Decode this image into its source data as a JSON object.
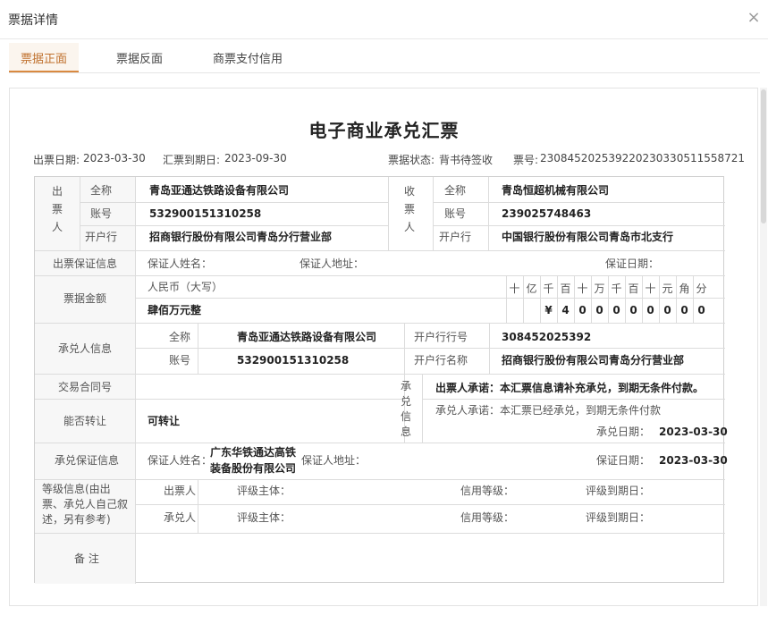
{
  "dialog": {
    "title": "票据详情",
    "close": "×"
  },
  "tabs": [
    {
      "label": "票据正面"
    },
    {
      "label": "票据反面"
    },
    {
      "label": "商票支付信用"
    }
  ],
  "bill": {
    "title": "电子商业承兑汇票",
    "issue_date_label": "出票日期:",
    "issue_date": "2023-03-30",
    "due_date_label": "汇票到期日:",
    "due_date": "2023-09-30",
    "status_label": "票据状态:",
    "status": "背书待签收",
    "number_label": "票号:",
    "number": "230845202539220230330511558721"
  },
  "drawer": {
    "side_label": "出票人",
    "name_label": "全称",
    "name": "青岛亚通达铁路设备有限公司",
    "account_label": "账号",
    "account": "532900151310258",
    "bank_label": "开户行",
    "bank": "招商银行股份有限公司青岛分行营业部"
  },
  "payee": {
    "side_label": "收票人",
    "name_label": "全称",
    "name": "青岛恒超机械有限公司",
    "account_label": "账号",
    "account": "239025748463",
    "bank_label": "开户行",
    "bank": "中国银行股份有限公司青岛市北支行"
  },
  "guarantee": {
    "label": "出票保证信息",
    "guarantor_name_label": "保证人姓名：",
    "guarantor_addr_label": "保证人地址：",
    "date_label": "保证日期："
  },
  "amount": {
    "label": "票据金额",
    "rmb_label": "人民币（大写）",
    "words": "肆佰万元整",
    "units": [
      "十",
      "亿",
      "千",
      "百",
      "十",
      "万",
      "千",
      "百",
      "十",
      "元",
      "角",
      "分"
    ],
    "digits": [
      "",
      "",
      "¥",
      "4",
      "0",
      "0",
      "0",
      "0",
      "0",
      "0",
      "0",
      "0"
    ]
  },
  "acceptor": {
    "label": "承兑人信息",
    "name_label": "全称",
    "name": "青岛亚通达铁路设备有限公司",
    "account_label": "账号",
    "account": "532900151310258",
    "bank_no_label": "开户行行号",
    "bank_no": "308452025392",
    "bank_name_label": "开户行名称",
    "bank_name": "招商银行股份有限公司青岛分行营业部"
  },
  "contract": {
    "label": "交易合同号"
  },
  "transferable": {
    "label": "能否转让",
    "value": "可转让"
  },
  "acceptance": {
    "side_label": "承兑信息",
    "drawer_promise": "出票人承诺：本汇票信息请补充承兑，到期无条件付款。",
    "acceptor_promise": "承兑人承诺：本汇票已经承兑，到期无条件付款",
    "date_label": "承兑日期：",
    "date": "2023-03-30"
  },
  "accept_guarantee": {
    "label": "承兑保证信息",
    "guarantor_name_label": "保证人姓名：",
    "guarantor_name_line1": "广东华铁通达高铁",
    "guarantor_name_line2": "装备股份有限公司",
    "guarantor_addr_label": "保证人地址：",
    "date_label": "保证日期：",
    "date": "2023-03-30"
  },
  "rating": {
    "label_line1": "等级信息(由出",
    "label_line2": "票、承兑人自己叙",
    "label_line3": "述，另有参考)",
    "drawer_label": "出票人",
    "acceptor_label": "承兑人",
    "subject_label": "评级主体：",
    "level_label": "信用等级：",
    "due_label": "评级到期日："
  },
  "remarks": {
    "label": "备 注"
  }
}
